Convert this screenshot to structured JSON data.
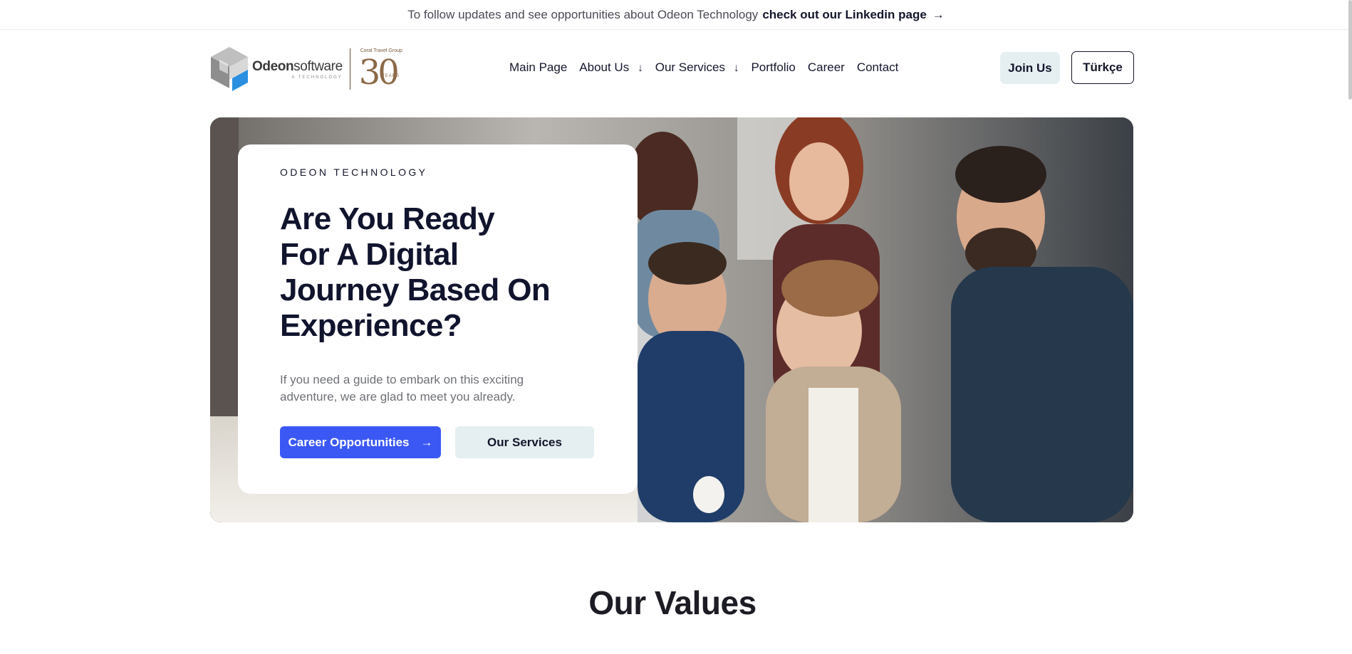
{
  "announcement": {
    "text": "To follow updates and see opportunities about Odeon Technology",
    "link": "check out our Linkedin page",
    "arrow": "→"
  },
  "logo": {
    "name_bold": "Odeon",
    "name_light": "software",
    "sub": "A TECHNOLOGY",
    "group": "Coral Travel Group",
    "anniversary_number": "30",
    "anniversary_word": "YEARS"
  },
  "nav": {
    "items": [
      {
        "label": "Main Page",
        "dropdown": false
      },
      {
        "label": "About Us",
        "dropdown": true,
        "chevron": "↓"
      },
      {
        "label": "Our Services",
        "dropdown": true,
        "chevron": "↓"
      },
      {
        "label": "Portfolio",
        "dropdown": false
      },
      {
        "label": "Career",
        "dropdown": false
      },
      {
        "label": "Contact",
        "dropdown": false
      }
    ]
  },
  "header": {
    "join_label": "Join Us",
    "language_label": "Türkçe"
  },
  "hero": {
    "eyebrow": "ODEON TECHNOLOGY",
    "headline": "Are You Ready For A Digital Journey Based On Experience?",
    "lead": "If you need a guide to embark on this exciting adventure, we are glad to meet you already.",
    "primary_cta": "Career Opportunities",
    "primary_arrow": "→",
    "secondary_cta": "Our Services"
  },
  "values": {
    "title": "Our Values"
  },
  "colors": {
    "primary": "#3b58f5",
    "soft_button": "#e5eff1",
    "ink": "#11142d",
    "brand_brown": "#8c6a48"
  }
}
